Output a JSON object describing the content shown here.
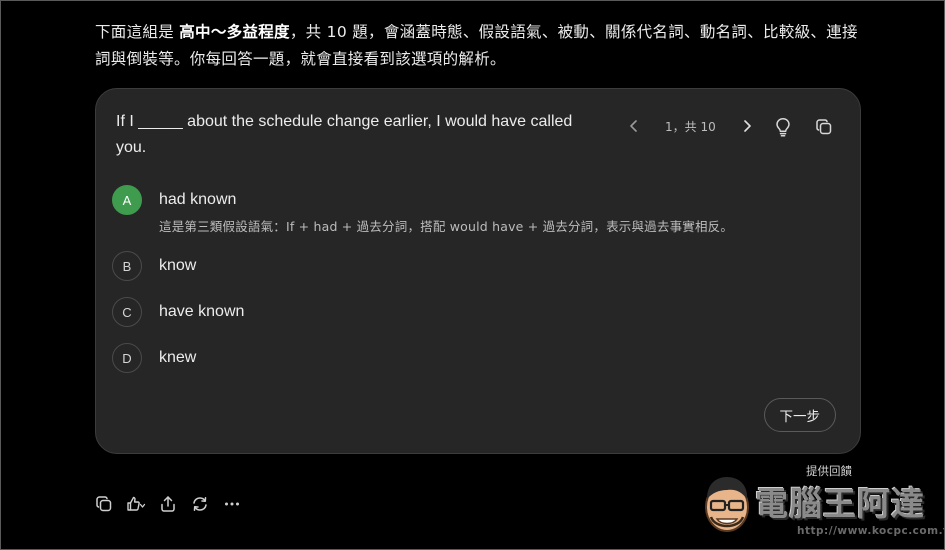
{
  "intro": {
    "part1": "下面這組是 ",
    "level": "高中～多益程度",
    "part2": "，共 10 題，會涵蓋時態、假設語氣、被動、關係代名詞、動名詞、比較級、連接詞與倒裝等。你每回答一題，就會直接看到該選項的解析。"
  },
  "quiz": {
    "question": "If I _____ about the schedule change earlier, I would have called you.",
    "pager": {
      "label": "1，共 10",
      "current": 1,
      "total": 10
    },
    "options": [
      {
        "letter": "A",
        "text": "had known",
        "correct": true,
        "explanation": "這是第三類假設語氣：If + had + 過去分詞，搭配 would have + 過去分詞，表示與過去事實相反。"
      },
      {
        "letter": "B",
        "text": "know",
        "correct": false
      },
      {
        "letter": "C",
        "text": "have known",
        "correct": false
      },
      {
        "letter": "D",
        "text": "knew",
        "correct": false
      }
    ],
    "next_label": "下一步",
    "icons": {
      "prev": "chevron-left-icon",
      "next": "chevron-right-icon",
      "hint": "lightbulb-icon",
      "copy": "copy-icon"
    }
  },
  "feedback_label": "提供回饋",
  "actions": {
    "icons": [
      "copy-icon",
      "thumbs-icon",
      "share-icon",
      "regenerate-icon",
      "more-icon"
    ]
  },
  "watermark": {
    "title": "電腦王阿達",
    "url": "http://www.kocpc.com.tw"
  },
  "colors": {
    "background": "#000000",
    "card": "#262626",
    "correct": "#3f9b4e",
    "text": "#ececec"
  }
}
